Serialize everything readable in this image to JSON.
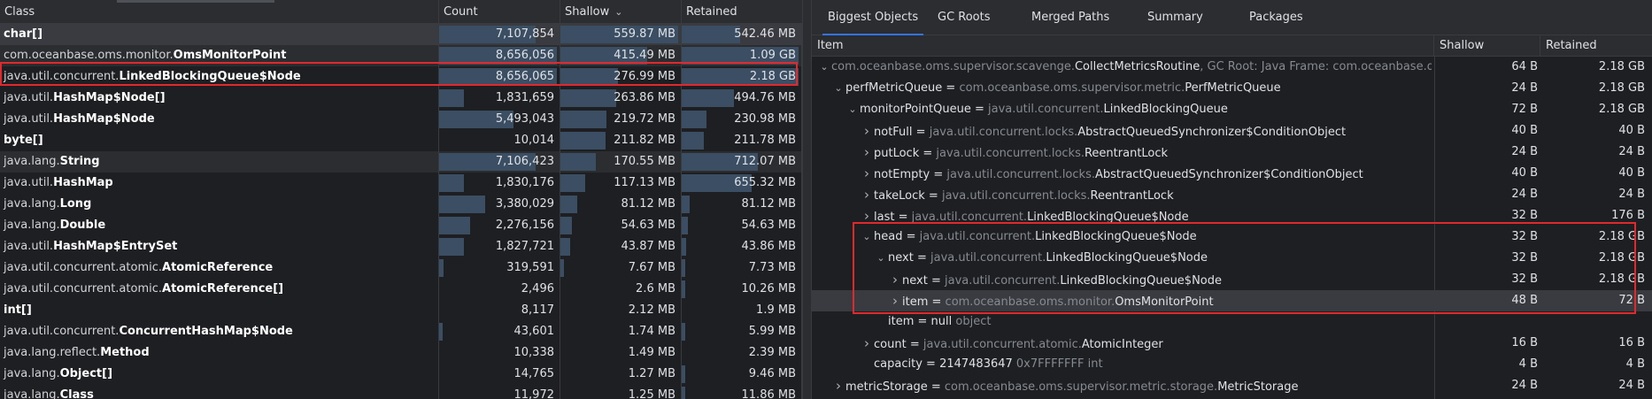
{
  "left_table": {
    "columns": {
      "class": "Class",
      "count": "Count",
      "shallow": "Shallow",
      "retained": "Retained"
    },
    "sort_icon": "chevron-down-icon",
    "rows": [
      {
        "pkg": "",
        "name": "char[]",
        "count": "7,107,854",
        "shallow": "559.87 MB",
        "retained": "542.46 MB",
        "count_frac": 0.82,
        "shallow_frac": 1.0,
        "retained_frac": 0.5
      },
      {
        "pkg": "com.oceanbase.oms.monitor.",
        "name": "OmsMonitorPoint",
        "count": "8,656,056",
        "shallow": "415.49 MB",
        "retained": "1.09 GB",
        "count_frac": 1.0,
        "shallow_frac": 0.74,
        "retained_frac": 1.0
      },
      {
        "pkg": "java.util.concurrent.",
        "name": "LinkedBlockingQueue$Node",
        "count": "8,656,065",
        "shallow": "276.99 MB",
        "retained": "2.18 GB",
        "count_frac": 1.0,
        "shallow_frac": 0.49,
        "retained_frac": 1.0
      },
      {
        "pkg": "java.util.",
        "name": "HashMap$Node[]",
        "count": "1,831,659",
        "shallow": "263.86 MB",
        "retained": "494.76 MB",
        "count_frac": 0.21,
        "shallow_frac": 0.47,
        "retained_frac": 0.45
      },
      {
        "pkg": "java.util.",
        "name": "HashMap$Node",
        "count": "5,493,043",
        "shallow": "219.72 MB",
        "retained": "230.98 MB",
        "count_frac": 0.63,
        "shallow_frac": 0.39,
        "retained_frac": 0.21
      },
      {
        "pkg": "",
        "name": "byte[]",
        "count": "10,014",
        "shallow": "211.82 MB",
        "retained": "211.78 MB",
        "count_frac": 0.0,
        "shallow_frac": 0.38,
        "retained_frac": 0.19
      },
      {
        "pkg": "java.lang.",
        "name": "String",
        "count": "7,106,423",
        "shallow": "170.55 MB",
        "retained": "712.07 MB",
        "count_frac": 0.82,
        "shallow_frac": 0.3,
        "retained_frac": 0.65
      },
      {
        "pkg": "java.util.",
        "name": "HashMap",
        "count": "1,830,176",
        "shallow": "117.13 MB",
        "retained": "655.32 MB",
        "count_frac": 0.21,
        "shallow_frac": 0.21,
        "retained_frac": 0.6
      },
      {
        "pkg": "java.lang.",
        "name": "Long",
        "count": "3,380,029",
        "shallow": "81.12 MB",
        "retained": "81.12 MB",
        "count_frac": 0.39,
        "shallow_frac": 0.14,
        "retained_frac": 0.07
      },
      {
        "pkg": "java.lang.",
        "name": "Double",
        "count": "2,276,156",
        "shallow": "54.63 MB",
        "retained": "54.63 MB",
        "count_frac": 0.26,
        "shallow_frac": 0.1,
        "retained_frac": 0.05
      },
      {
        "pkg": "java.util.",
        "name": "HashMap$EntrySet",
        "count": "1,827,721",
        "shallow": "43.87 MB",
        "retained": "43.86 MB",
        "count_frac": 0.21,
        "shallow_frac": 0.08,
        "retained_frac": 0.04
      },
      {
        "pkg": "java.util.concurrent.atomic.",
        "name": "AtomicReference",
        "count": "319,591",
        "shallow": "7.67 MB",
        "retained": "7.73 MB",
        "count_frac": 0.04,
        "shallow_frac": 0.01,
        "retained_frac": 0.01
      },
      {
        "pkg": "java.util.concurrent.atomic.",
        "name": "AtomicReference[]",
        "count": "2,496",
        "shallow": "2.6 MB",
        "retained": "10.26 MB",
        "count_frac": 0.0,
        "shallow_frac": 0.0,
        "retained_frac": 0.01
      },
      {
        "pkg": "",
        "name": "int[]",
        "count": "8,117",
        "shallow": "2.12 MB",
        "retained": "1.9 MB",
        "count_frac": 0.0,
        "shallow_frac": 0.0,
        "retained_frac": 0.0
      },
      {
        "pkg": "java.util.concurrent.",
        "name": "ConcurrentHashMap$Node",
        "count": "43,601",
        "shallow": "1.74 MB",
        "retained": "5.99 MB",
        "count_frac": 0.01,
        "shallow_frac": 0.0,
        "retained_frac": 0.01
      },
      {
        "pkg": "java.lang.reflect.",
        "name": "Method",
        "count": "10,338",
        "shallow": "1.49 MB",
        "retained": "2.39 MB",
        "count_frac": 0.0,
        "shallow_frac": 0.0,
        "retained_frac": 0.0
      },
      {
        "pkg": "java.lang.",
        "name": "Object[]",
        "count": "14,765",
        "shallow": "1.27 MB",
        "retained": "9.46 MB",
        "count_frac": 0.0,
        "shallow_frac": 0.0,
        "retained_frac": 0.01
      },
      {
        "pkg": "java.lang.",
        "name": "Class",
        "count": "11,972",
        "shallow": "1.25 MB",
        "retained": "11.86 MB",
        "count_frac": 0.0,
        "shallow_frac": 0.0,
        "retained_frac": 0.01
      }
    ]
  },
  "right_panel": {
    "tabs": [
      "Biggest Objects",
      "GC Roots",
      "Merged Paths",
      "Summary",
      "Packages"
    ],
    "active_tab": 0,
    "columns": {
      "item": "Item",
      "shallow": "Shallow",
      "retained": "Retained"
    },
    "rows": [
      {
        "chev": "down",
        "field": "",
        "type_pkg": "com.oceanbase.oms.supervisor.scavenge.",
        "type_name": "CollectMetricsRoutine",
        "extra": ", GC Root: Java Frame: com.oceanbase.oms",
        "shallow": "64 B",
        "retained": "2.18 GB"
      },
      {
        "chev": "down",
        "field": "perfMetricQueue",
        "type_pkg": "com.oceanbase.oms.supervisor.metric.",
        "type_name": "PerfMetricQueue",
        "extra": "",
        "shallow": "24 B",
        "retained": "2.18 GB"
      },
      {
        "chev": "down",
        "field": "monitorPointQueue",
        "type_pkg": "java.util.concurrent.",
        "type_name": "LinkedBlockingQueue",
        "extra": "",
        "shallow": "72 B",
        "retained": "2.18 GB"
      },
      {
        "chev": "right",
        "field": "notFull",
        "type_pkg": "java.util.concurrent.locks.",
        "type_name": "AbstractQueuedSynchronizer$ConditionObject",
        "extra": "",
        "shallow": "40 B",
        "retained": "40 B"
      },
      {
        "chev": "right",
        "field": "putLock",
        "type_pkg": "java.util.concurrent.locks.",
        "type_name": "ReentrantLock",
        "extra": "",
        "shallow": "24 B",
        "retained": "24 B"
      },
      {
        "chev": "right",
        "field": "notEmpty",
        "type_pkg": "java.util.concurrent.locks.",
        "type_name": "AbstractQueuedSynchronizer$ConditionObject",
        "extra": "",
        "shallow": "40 B",
        "retained": "40 B"
      },
      {
        "chev": "right",
        "field": "takeLock",
        "type_pkg": "java.util.concurrent.locks.",
        "type_name": "ReentrantLock",
        "extra": "",
        "shallow": "24 B",
        "retained": "24 B"
      },
      {
        "chev": "right",
        "field": "last",
        "type_pkg": "java.util.concurrent.",
        "type_name": "LinkedBlockingQueue$Node",
        "extra": "",
        "shallow": "32 B",
        "retained": "176 B"
      },
      {
        "chev": "down",
        "field": "head",
        "type_pkg": "java.util.concurrent.",
        "type_name": "LinkedBlockingQueue$Node",
        "extra": "",
        "shallow": "32 B",
        "retained": "2.18 GB"
      },
      {
        "chev": "down",
        "field": "next",
        "type_pkg": "java.util.concurrent.",
        "type_name": "LinkedBlockingQueue$Node",
        "extra": "",
        "shallow": "32 B",
        "retained": "2.18 GB"
      },
      {
        "chev": "right",
        "field": "next",
        "type_pkg": "java.util.concurrent.",
        "type_name": "LinkedBlockingQueue$Node",
        "extra": "",
        "shallow": "32 B",
        "retained": "2.18 GB"
      },
      {
        "chev": "right",
        "field": "item",
        "type_pkg": "com.oceanbase.oms.monitor.",
        "type_name": "OmsMonitorPoint",
        "extra": "",
        "shallow": "48 B",
        "retained": "72 B"
      },
      {
        "chev": "none",
        "field": "item",
        "type_pkg": "",
        "type_name": "null",
        "extra": " object",
        "shallow": "",
        "retained": ""
      },
      {
        "chev": "right",
        "field": "count",
        "type_pkg": "java.util.concurrent.atomic.",
        "type_name": "AtomicInteger",
        "extra": "",
        "shallow": "16 B",
        "retained": "16 B"
      },
      {
        "chev": "none",
        "field": "capacity",
        "type_pkg": "",
        "type_name": "2147483647",
        "extra": " 0x7FFFFFFF  int",
        "shallow": "4 B",
        "retained": "4 B"
      },
      {
        "chev": "right",
        "field": "metricStorage",
        "type_pkg": "com.oceanbase.oms.supervisor.metric.storage.",
        "type_name": "MetricStorage",
        "extra": "",
        "shallow": "24 B",
        "retained": "24 B"
      }
    ]
  },
  "colors": {
    "background": "#1e1f22",
    "header": "#2b2d30",
    "selection": "#393b40",
    "bar": "#3b4e63",
    "accent": "#3574f0",
    "highlight_box": "#e0292e"
  }
}
